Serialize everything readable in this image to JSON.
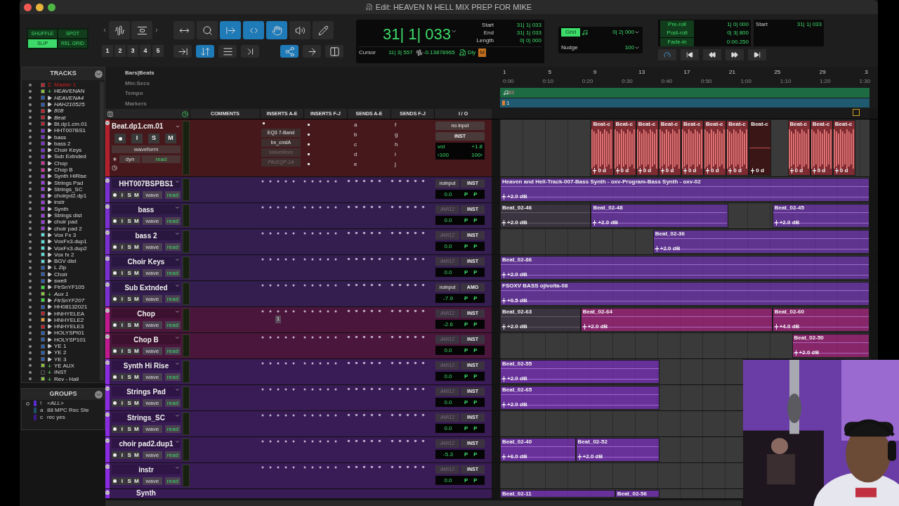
{
  "window": {
    "title": "Edit: HEAVEN N HELL MIX PREP FOR MIKE"
  },
  "edit_modes": [
    {
      "label": "SHUFFLE",
      "selected": false
    },
    {
      "label": "SPOT",
      "selected": false
    },
    {
      "label": "SLIP",
      "selected": true
    },
    {
      "label": "REL GRID",
      "selected": false
    }
  ],
  "zoom_tools": [
    {
      "kind": "zoom-waveform",
      "selected": false
    },
    {
      "kind": "zoom-vertical",
      "selected": false
    }
  ],
  "zoom_presets": [
    "1",
    "2",
    "3",
    "4",
    "5"
  ],
  "tools": [
    {
      "kind": "zoom-toggle",
      "selected": false
    },
    {
      "kind": "zoomer",
      "selected": false
    },
    {
      "kind": "trimmer",
      "selected": true
    },
    {
      "kind": "selector",
      "selected": true
    },
    {
      "kind": "grabber",
      "selected": true
    },
    {
      "kind": "scrubber",
      "selected": false
    },
    {
      "kind": "pencil",
      "selected": false
    }
  ],
  "tools_row2": [
    {
      "kind": "tab",
      "selected": false
    },
    {
      "kind": "tab-transient",
      "selected": true
    },
    {
      "kind": "mirror",
      "selected": false
    },
    {
      "kind": "insertion",
      "selected": false
    },
    {
      "kind": "link",
      "selected": true
    },
    {
      "kind": "link-track",
      "selected": false
    },
    {
      "kind": "window",
      "selected": false
    }
  ],
  "main_counter": "31| 1| 033",
  "selection": [
    {
      "label": "Start",
      "value": "31| 1| 033"
    },
    {
      "label": "End",
      "value": "31| 1| 033"
    },
    {
      "label": "Length",
      "value": "0| 0| 000"
    }
  ],
  "cursor": {
    "label": "Cursor",
    "position": "11| 3| 557",
    "sample": "-0.13878965"
  },
  "counter_flags": {
    "delay": "Dly",
    "midi": "M"
  },
  "grid": {
    "label": "Grid",
    "value": "0| 2| 000",
    "on": true
  },
  "nudge": {
    "label": "Nudge",
    "value": "100"
  },
  "prepost": [
    {
      "label": "Pre-roll",
      "value": "1| 0| 000"
    },
    {
      "label": "Post-roll",
      "value": "0| 3| 800"
    },
    {
      "label": "Fade-in",
      "value": "0:00.250"
    }
  ],
  "transport_start": {
    "label": "Start",
    "value": "31| 1| 033"
  },
  "tracks_panel": {
    "title": "TRACKS",
    "items": [
      {
        "name": "Master 1",
        "color": "#c0212b",
        "kind": "master",
        "inactive": false
      },
      {
        "name": "HEAVENAN",
        "color": "#8cc63e",
        "kind": "aux",
        "inactive": false
      },
      {
        "name": "HEAVENA4",
        "color": "#2a5db0",
        "kind": "inst",
        "inactive": true
      },
      {
        "name": "HAH210525",
        "color": "#2a5db0",
        "kind": "inst",
        "inactive": true
      },
      {
        "name": "808",
        "color": "#c0212b",
        "kind": "inst",
        "inactive": true
      },
      {
        "name": "Beat",
        "color": "#c0212b",
        "kind": "inst",
        "inactive": true
      },
      {
        "name": "Bt.dp1.cm.01",
        "color": "#c0212b",
        "kind": "inst",
        "inactive": false
      },
      {
        "name": "HHT007BS1",
        "color": "#7a2fd0",
        "kind": "inst",
        "inactive": false
      },
      {
        "name": "bass",
        "color": "#7a2fd0",
        "kind": "inst",
        "inactive": false
      },
      {
        "name": "bass 2",
        "color": "#7a2fd0",
        "kind": "inst",
        "inactive": false
      },
      {
        "name": "Choir Keys",
        "color": "#7a2fd0",
        "kind": "inst",
        "inactive": false
      },
      {
        "name": "Sub Extnded",
        "color": "#7a2fd0",
        "kind": "inst",
        "inactive": false
      },
      {
        "name": "Chop",
        "color": "#d0309a",
        "kind": "inst",
        "inactive": false
      },
      {
        "name": "Chop B",
        "color": "#d0309a",
        "kind": "inst",
        "inactive": false
      },
      {
        "name": "Synth HiRise",
        "color": "#9a3ae0",
        "kind": "inst",
        "inactive": false
      },
      {
        "name": "Strings Pad",
        "color": "#9a3ae0",
        "kind": "inst",
        "inactive": false
      },
      {
        "name": "Strings_SC",
        "color": "#9a3ae0",
        "kind": "inst",
        "inactive": false
      },
      {
        "name": "choirpd2.dp1",
        "color": "#9a3ae0",
        "kind": "inst",
        "inactive": false
      },
      {
        "name": "instr",
        "color": "#9a3ae0",
        "kind": "inst",
        "inactive": false
      },
      {
        "name": "Synth",
        "color": "#9a3ae0",
        "kind": "inst",
        "inactive": false
      },
      {
        "name": "Strings dist",
        "color": "#9a3ae0",
        "kind": "inst",
        "inactive": false
      },
      {
        "name": "choir pad",
        "color": "#9a3ae0",
        "kind": "inst",
        "inactive": false
      },
      {
        "name": "choir pad 2",
        "color": "#9a3ae0",
        "kind": "inst",
        "inactive": false
      },
      {
        "name": "Vox Fx 3",
        "color": "#5ee0da",
        "kind": "inst",
        "inactive": false
      },
      {
        "name": "VoxFx3.dup1",
        "color": "#5ee0da",
        "kind": "inst",
        "inactive": false
      },
      {
        "name": "VoxFx3.dup2",
        "color": "#5ee0da",
        "kind": "inst",
        "inactive": false
      },
      {
        "name": "Vox fx 2",
        "color": "#5ee0da",
        "kind": "inst",
        "inactive": false
      },
      {
        "name": "BGV dist",
        "color": "#5ee0da",
        "kind": "inst",
        "inactive": false
      },
      {
        "name": "L Zip",
        "color": "#2a5db0",
        "kind": "inst",
        "inactive": false
      },
      {
        "name": "Choir",
        "color": "#2a5db0",
        "kind": "inst",
        "inactive": false
      },
      {
        "name": "swell",
        "color": "#2a5db0",
        "kind": "inst",
        "inactive": false
      },
      {
        "name": "FtrSnYF105",
        "color": "#3ee03e",
        "kind": "inst",
        "inactive": false
      },
      {
        "name": "Aux 1",
        "color": "#8cc63e",
        "kind": "aux",
        "inactive": true
      },
      {
        "name": "FtrSnYF207",
        "color": "#3ee03e",
        "kind": "inst",
        "inactive": true
      },
      {
        "name": "HH08132021",
        "color": "#2a5db0",
        "kind": "inst",
        "inactive": false
      },
      {
        "name": "HNHYELEA",
        "color": "#c0212b",
        "kind": "inst",
        "inactive": false
      },
      {
        "name": "HNHYELE2",
        "color": "#f0a030",
        "kind": "inst",
        "inactive": false
      },
      {
        "name": "HNHYELE3",
        "color": "#c0212b",
        "kind": "inst",
        "inactive": false
      },
      {
        "name": "HOLYSPI01",
        "color": "#2a5db0",
        "kind": "inst",
        "inactive": false
      },
      {
        "name": "HOLYSP101",
        "color": "#2a5db0",
        "kind": "inst",
        "inactive": false
      },
      {
        "name": "YE 1",
        "color": "#2a5db0",
        "kind": "inst",
        "inactive": false
      },
      {
        "name": "YE 2",
        "color": "#2a5db0",
        "kind": "inst",
        "inactive": false
      },
      {
        "name": "YE 3",
        "color": "#2a5db0",
        "kind": "inst",
        "inactive": false
      },
      {
        "name": "YE AUX",
        "color": "#8cc63e",
        "kind": "aux",
        "inactive": false
      },
      {
        "name": "INST",
        "color": "#1c1c1c",
        "kind": "aux",
        "inactive": false
      },
      {
        "name": "Rev - Hall",
        "color": "#8cc63e",
        "kind": "aux",
        "inactive": false
      }
    ]
  },
  "groups_panel": {
    "title": "GROUPS",
    "items": [
      {
        "letter": "!",
        "name": "<ALL>",
        "color": "#5a2bd6",
        "selected": true
      },
      {
        "letter": "a",
        "name": "88 MPC Rec Ste",
        "color": "#1f4f6a",
        "selected": false
      },
      {
        "letter": "c",
        "name": "rec yes",
        "color": "#3a1a8a",
        "selected": false
      }
    ]
  },
  "ruler_labels": [
    "Bars|Beats",
    "Min:Secs",
    "Tempo",
    "Markers"
  ],
  "bar_numbers": [
    "1",
    "5",
    "9",
    "13",
    "17",
    "21",
    "25",
    "29",
    "3"
  ],
  "time_marks": [
    "0:00",
    "0:10",
    "0:20",
    "0:30",
    "0:40",
    "0:50",
    "1:00",
    "1:10",
    "1:20",
    "1:30"
  ],
  "tempo_marker": "83",
  "marker": "1",
  "columns": [
    "COMMENTS",
    "INSERTS A-E",
    "INSERTS F-J",
    "SENDS A-E",
    "SENDS F-J",
    "I / O"
  ],
  "edit_tracks": [
    {
      "kind": "expanded",
      "name": "Beat.dp1.cm.01",
      "color": "#b3202c",
      "buttons": [
        "I",
        "S",
        "M"
      ],
      "playlist_view": "waveform",
      "dyn": "dyn",
      "automation": "read",
      "inserts": [
        {
          "name": "EQ3 7-Band",
          "active": true
        },
        {
          "name": "bx_cnslA",
          "active": true
        },
        {
          "name": "VelvetRom",
          "active": false
        },
        {
          "name": "PltcEQP-1A",
          "active": false
        }
      ],
      "sends_ae": [
        "a",
        "b",
        "c",
        "d",
        "e"
      ],
      "sends_fj": [
        "f",
        "g",
        "h",
        "i",
        "j"
      ],
      "input": "no input",
      "output": "INST",
      "vol_label": "vol",
      "volume": "+1.8",
      "pan_left": "‹100",
      "pan_right": "100›",
      "clips": [
        {
          "name": "Beat-c",
          "gain": "0 d",
          "dimmed": false
        },
        {
          "name": "Beat-c",
          "gain": "0 d",
          "dimmed": false
        },
        {
          "name": "Beat-c",
          "gain": "0 d",
          "dimmed": false
        },
        {
          "name": "Beat-c",
          "gain": "0 d",
          "dimmed": false
        },
        {
          "name": "Beat-c",
          "gain": "0 d",
          "dimmed": false
        },
        {
          "name": "Beat-c",
          "gain": "0 d",
          "dimmed": false
        },
        {
          "name": "Beat-c",
          "gain": "0 d",
          "dimmed": false
        },
        {
          "name": "Beat-c",
          "gain": "0 d",
          "dimmed": true
        },
        {
          "name": "Beat-c",
          "gain": "0 d",
          "dimmed": false
        },
        {
          "name": "Beat-c",
          "gain": "0 d",
          "dimmed": false
        },
        {
          "name": "Beat-c",
          "gain": "0 d",
          "dimmed": false
        }
      ]
    },
    {
      "kind": "compact",
      "name": "HHT007BSPBS1",
      "color": "#7a2fd0",
      "buttons": [
        "I",
        "S",
        "M"
      ],
      "view": "wave",
      "automation": "read",
      "input": "noinput",
      "input_active": true,
      "output": "INST",
      "volume": "0.0",
      "pans": [
        "P",
        "P"
      ],
      "clips": [
        {
          "name": "Heaven and Hell-Track-007-Bass Synth - oxv-Program-Bass Synth - oxv-02",
          "gain": "+2.0 dB",
          "dimmed": false
        }
      ]
    },
    {
      "kind": "compact",
      "name": "bass",
      "color": "#7a2fd0",
      "buttons": [
        "I",
        "S",
        "M"
      ],
      "view": "wave",
      "automation": "read",
      "input": "AMI12",
      "input_active": false,
      "output": "INST",
      "volume": "0.0",
      "pans": [
        "P",
        "P"
      ],
      "clips": [
        {
          "name": "Beat_02-46",
          "gain": "+2.0 dB",
          "dimmed": true
        },
        {
          "name": "Beat_02-48",
          "gain": "+2.0 dB",
          "dimmed": false
        },
        {
          "name": "Beat_02-45",
          "gain": "+2.0 dB",
          "dimmed": false
        }
      ]
    },
    {
      "kind": "compact",
      "name": "bass 2",
      "color": "#7a2fd0",
      "buttons": [
        "I",
        "S",
        "M"
      ],
      "view": "wave",
      "automation": "read",
      "input": "AMI12",
      "input_active": false,
      "output": "INST",
      "volume": "0.0",
      "pans": [
        "P",
        "P"
      ],
      "clips": [
        {
          "name": "Beat_02-36",
          "gain": "+2.0 dB",
          "dimmed": false
        }
      ]
    },
    {
      "kind": "compact",
      "name": "Choir Keys",
      "color": "#7a2fd0",
      "buttons": [
        "I",
        "S",
        "M"
      ],
      "view": "wave",
      "automation": "read",
      "input": "AMI12",
      "input_active": false,
      "output": "INST",
      "volume": "0.0",
      "pans": [
        "P",
        "P"
      ],
      "clips": [
        {
          "name": "Beat_02-86",
          "gain": "+2.0 dB",
          "dimmed": false
        }
      ]
    },
    {
      "kind": "compact",
      "name": "Sub Extnded",
      "color": "#7a2fd0",
      "buttons": [
        "I",
        "S",
        "M"
      ],
      "view": "wave",
      "automation": "read",
      "input": "noinput",
      "input_active": true,
      "output": "AMO",
      "volume": "-7.9",
      "pans": [
        "P",
        "P"
      ],
      "clips": [
        {
          "name": "FSOXV BASS ojivolta-08",
          "gain": "+0.5 dB",
          "dimmed": false
        }
      ]
    },
    {
      "kind": "compact",
      "name": "Chop",
      "color": "#c2188f",
      "buttons": [
        "I",
        "S",
        "M"
      ],
      "view": "wave",
      "automation": "read",
      "input": "AMI12",
      "input_active": false,
      "output": "INST",
      "volume": "-2.6",
      "pans": [
        "P",
        "P"
      ],
      "insert_badge": "1",
      "clips": [
        {
          "name": "Beat_02-63",
          "gain": "+2.0 dB",
          "dimmed": true
        },
        {
          "name": "Beat_02-64",
          "gain": "+2.0 dB",
          "dimmed": false
        },
        {
          "name": "Beat_02-60",
          "gain": "+4.0 dB",
          "dimmed": false
        }
      ]
    },
    {
      "kind": "compact",
      "name": "Chop B",
      "color": "#c2188f",
      "buttons": [
        "I",
        "S",
        "M"
      ],
      "view": "wave",
      "automation": "read",
      "input": "AMI12",
      "input_active": false,
      "output": "INST",
      "volume": "0.0",
      "pans": [
        "P",
        "P"
      ],
      "clips": [
        {
          "name": "Beat_02-50",
          "gain": "+2.0 dB",
          "dimmed": false
        }
      ]
    },
    {
      "kind": "compact",
      "name": "Synth Hi Rise",
      "color": "#8a2be2",
      "buttons": [
        "I",
        "S",
        "M"
      ],
      "view": "wave",
      "automation": "read",
      "input": "AMI12",
      "input_active": false,
      "output": "INST",
      "volume": "0.0",
      "pans": [
        "P",
        "P"
      ],
      "clips": [
        {
          "name": "Beat_02-55",
          "gain": "+2.0 dB",
          "dimmed": false
        }
      ]
    },
    {
      "kind": "compact",
      "name": "Strings Pad",
      "color": "#8a2be2",
      "buttons": [
        "I",
        "S",
        "M"
      ],
      "view": "wave",
      "automation": "read",
      "input": "AMI12",
      "input_active": false,
      "output": "INST",
      "volume": "0.0",
      "pans": [
        "P",
        "P"
      ],
      "clips": [
        {
          "name": "Beat_02-65",
          "gain": "+2.0 dB",
          "dimmed": false
        }
      ]
    },
    {
      "kind": "compact",
      "name": "Strings_SC",
      "color": "#8a2be2",
      "buttons": [
        "I",
        "S",
        "M"
      ],
      "view": "wave",
      "automation": "read",
      "input": "AMI12",
      "input_active": false,
      "output": "INST",
      "volume": "0.0",
      "pans": [
        "P",
        "P"
      ]
    },
    {
      "kind": "compact",
      "name": "choir pad2.dup1",
      "color": "#8a2be2",
      "buttons": [
        "I",
        "S",
        "M"
      ],
      "view": "wave",
      "automation": "read",
      "input": "AMI12",
      "input_active": false,
      "output": "INST",
      "volume": "-5.3",
      "pans": [
        "P",
        "P"
      ],
      "clips": [
        {
          "name": "Beat_02-40",
          "gain": "+6.0 dB",
          "dimmed": false
        },
        {
          "name": "Beat_02-52",
          "gain": "+2.0 dB",
          "dimmed": false
        }
      ]
    },
    {
      "kind": "compact",
      "name": "instr",
      "color": "#8a2be2",
      "buttons": [
        "I",
        "S",
        "M"
      ],
      "view": "wave",
      "automation": "read",
      "input": "AMI12",
      "input_active": false,
      "output": "INST",
      "volume": "0.0",
      "pans": [
        "P",
        "P"
      ]
    },
    {
      "kind": "partial",
      "name": "Synth",
      "color": "#8a2be2",
      "clips": [
        {
          "name": "Beat_02-11",
          "dimmed": false
        },
        {
          "name": "Beat_02-56",
          "dimmed": false
        }
      ]
    }
  ]
}
